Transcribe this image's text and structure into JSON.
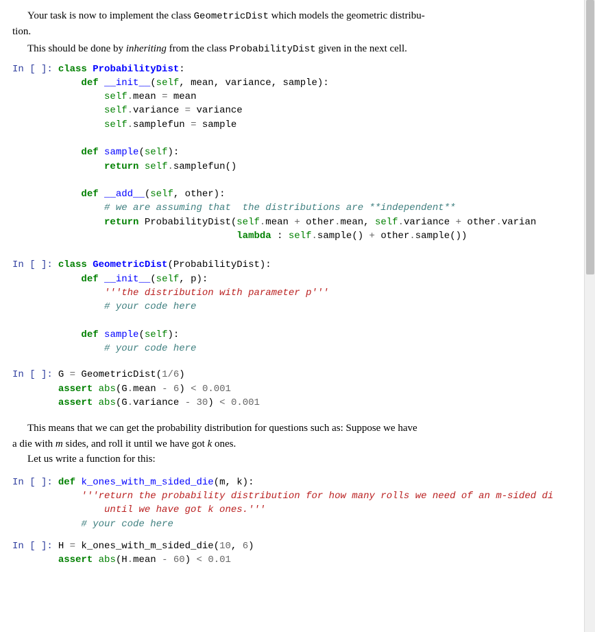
{
  "prose": {
    "p1_a": "Your task is now to implement the class ",
    "p1_code": "GeometricDist",
    "p1_b": " which models the geometric distribu-",
    "p1_c": "tion.",
    "p2_a": "This should be done by ",
    "p2_em": "inheriting",
    "p2_b": " from the class ",
    "p2_code": "ProbabilityDist",
    "p2_c": " given in the next cell.",
    "p3_a": "This means that we can get the probability distribution for questions such as: Suppose we have",
    "p3_b": "a die with ",
    "p3_m": "m",
    "p3_c": " sides, and roll it until we have got ",
    "p3_k": "k",
    "p3_d": " ones.",
    "p4": "Let us write a function for this:"
  },
  "prompt": "In [ ]:",
  "code": {
    "cell1": {
      "l1": {
        "kw": "class",
        "sp": " ",
        "nc": "ProbabilityDist",
        "rest": ":"
      },
      "l2": {
        "pad": "    ",
        "kw": "def",
        "sp": " ",
        "nf": "__init__",
        "rest1": "(",
        "sf": "self",
        "rest2": ", mean, variance, sample):"
      },
      "l3": {
        "pad": "        ",
        "sf": "self",
        "op1": ".",
        "attr": "mean ",
        "op2": "=",
        "rest": " mean"
      },
      "l4": {
        "pad": "        ",
        "sf": "self",
        "op1": ".",
        "attr": "variance ",
        "op2": "=",
        "rest": " variance"
      },
      "l5": {
        "pad": "        ",
        "sf": "self",
        "op1": ".",
        "attr": "samplefun ",
        "op2": "=",
        "rest": " sample"
      },
      "l6": {
        "pad": "    ",
        "kw": "def",
        "sp": " ",
        "nf": "sample",
        "rest1": "(",
        "sf": "self",
        "rest2": "):"
      },
      "l7": {
        "pad": "        ",
        "kw": "return",
        "sp": " ",
        "sf": "self",
        "op1": ".",
        "rest": "samplefun()"
      },
      "l8": {
        "pad": "    ",
        "kw": "def",
        "sp": " ",
        "nf": "__add__",
        "rest1": "(",
        "sf": "self",
        "rest2": ", other):"
      },
      "l9": {
        "pad": "        ",
        "cm": "# we are assuming that  the distributions are **independent**"
      },
      "l10": {
        "pad": "        ",
        "kw": "return",
        "sp": " ",
        "rest1": "ProbabilityDist(",
        "sf1": "self",
        "op1": ".",
        "a1": "mean ",
        "op2": "+",
        "rest2": " other",
        "op3": ".",
        "a2": "mean, ",
        "sf2": "self",
        "op4": ".",
        "a3": "variance ",
        "op5": "+",
        "rest3": " other",
        "op6": ".",
        "a4": "varian"
      },
      "l11": {
        "pad": "                               ",
        "kw": "lambda",
        "rest1": " : ",
        "sf1": "self",
        "op1": ".",
        "rest2": "sample() ",
        "op2": "+",
        "rest3": " other",
        "op3": ".",
        "rest4": "sample())"
      }
    },
    "cell2": {
      "l1": {
        "kw": "class",
        "sp": " ",
        "nc": "GeometricDist",
        "rest": "(ProbabilityDist):"
      },
      "l2": {
        "pad": "    ",
        "kw": "def",
        "sp": " ",
        "nf": "__init__",
        "rest1": "(",
        "sf": "self",
        "rest2": ", p):"
      },
      "l3": {
        "pad": "        ",
        "ds": "'''the distribution with parameter p'''"
      },
      "l4": {
        "pad": "        ",
        "cm": "# your code here"
      },
      "l5": {
        "pad": "    ",
        "kw": "def",
        "sp": " ",
        "nf": "sample",
        "rest1": "(",
        "sf": "self",
        "rest2": "):"
      },
      "l6": {
        "pad": "        ",
        "cm": "# your code here"
      }
    },
    "cell3": {
      "l1": {
        "rest1": "G ",
        "op1": "=",
        "rest2": " GeometricDist(",
        "num1": "1",
        "op2": "/",
        "num2": "6",
        "rest3": ")"
      },
      "l2": {
        "kw": "assert",
        "sp": " ",
        "bi": "abs",
        "rest1": "(G",
        "op1": ".",
        "rest2": "mean ",
        "op2": "-",
        "sp2": " ",
        "num1": "6",
        "rest3": ") ",
        "op3": "<",
        "sp3": " ",
        "num2": "0.001"
      },
      "l3": {
        "kw": "assert",
        "sp": " ",
        "bi": "abs",
        "rest1": "(G",
        "op1": ".",
        "rest2": "variance ",
        "op2": "-",
        "sp2": " ",
        "num1": "30",
        "rest3": ") ",
        "op3": "<",
        "sp3": " ",
        "num2": "0.001"
      }
    },
    "cell4": {
      "l1": {
        "kw": "def",
        "sp": " ",
        "nf": "k_ones_with_m_sided_die",
        "rest": "(m, k):"
      },
      "l2": {
        "pad": "    ",
        "ds": "'''return the probability distribution for how many rolls we need of an m-sided di"
      },
      "l3": {
        "pad": "        ",
        "ds": "until we have got k ones.'''"
      },
      "l4": {
        "pad": "    ",
        "cm": "# your code here"
      }
    },
    "cell5": {
      "l1": {
        "rest1": "H ",
        "op1": "=",
        "rest2": " k_ones_with_m_sided_die(",
        "num1": "10",
        "rest3": ", ",
        "num2": "6",
        "rest4": ")"
      },
      "l2": {
        "kw": "assert",
        "sp": " ",
        "bi": "abs",
        "rest1": "(H",
        "op1": ".",
        "rest2": "mean ",
        "op2": "-",
        "sp2": " ",
        "num1": "60",
        "rest3": ") ",
        "op3": "<",
        "sp3": " ",
        "num2": "0.01"
      }
    }
  }
}
